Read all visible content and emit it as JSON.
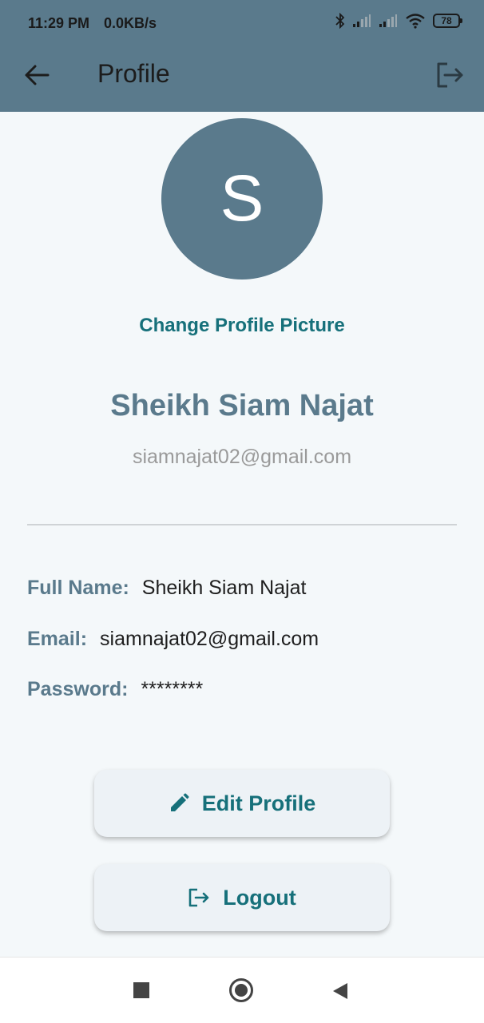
{
  "status_bar": {
    "time": "11:29 PM",
    "speed": "0.0KB/s",
    "battery": "78",
    "icons": [
      "bluetooth-icon",
      "signal-icon",
      "signal-icon",
      "wifi-icon",
      "battery-icon"
    ]
  },
  "toolbar": {
    "title": "Profile",
    "back_icon": "arrow-left-icon",
    "logout_icon": "logout-icon"
  },
  "profile": {
    "avatar_initial": "S",
    "change_picture_label": "Change Profile Picture",
    "name": "Sheikh Siam Najat",
    "email": "siamnajat02@gmail.com"
  },
  "details": [
    {
      "label": "Full Name:",
      "value": "Sheikh Siam Najat"
    },
    {
      "label": "Email:",
      "value": "siamnajat02@gmail.com"
    },
    {
      "label": "Password:",
      "value": "********"
    }
  ],
  "actions": {
    "edit_label": "Edit Profile",
    "edit_icon": "pencil-icon",
    "logout_label": "Logout",
    "logout_icon": "logout-icon"
  },
  "colors": {
    "appbar": "#5a7a8c",
    "accent": "#16707a",
    "background": "#f4f8fa",
    "button": "#edf2f6"
  },
  "nav_bar": {
    "icons": [
      "recents-square-icon",
      "home-circle-icon",
      "back-triangle-icon"
    ]
  }
}
